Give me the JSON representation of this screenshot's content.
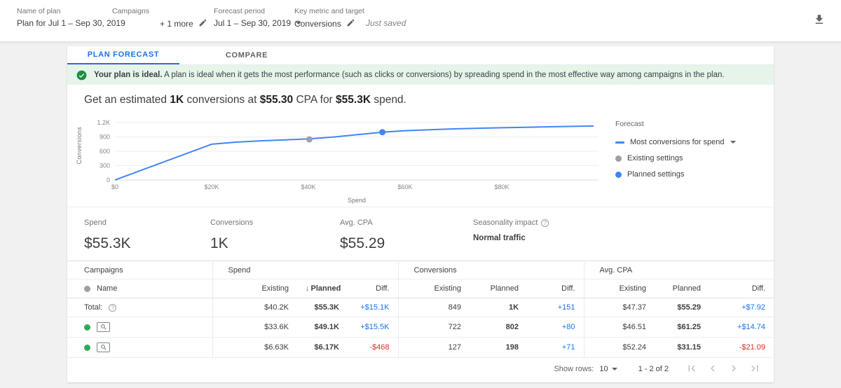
{
  "topbar": {
    "plan": {
      "label": "Name of plan",
      "value": "Plan for Jul 1 – Sep 30, 2019"
    },
    "campaigns": {
      "label": "Campaigns",
      "value": "+ 1 more"
    },
    "forecast_period": {
      "label": "Forecast period",
      "value": "Jul 1 – Sep 30, 2019"
    },
    "key_metric": {
      "label": "Key metric and target",
      "value": "Conversions"
    },
    "save_status": "Just saved"
  },
  "tabs": {
    "plan_forecast": "PLAN FORECAST",
    "compare": "COMPARE"
  },
  "banner": {
    "title": "Your plan is ideal.",
    "body": "A plan is ideal when it gets the most performance (such as clicks or conversions) by spreading spend in the most effective way among campaigns in the plan."
  },
  "headline": {
    "p1": "Get an estimated ",
    "b1": "1K",
    "p2": " conversions at ",
    "b2": "$55.30",
    "p3": " CPA for ",
    "b3": "$55.3K",
    "p4": " spend."
  },
  "chart_data": {
    "type": "line",
    "title": "Forecast: conversions vs spend",
    "xlabel": "Spend",
    "ylabel": "Conversions",
    "xlim": [
      0,
      100000
    ],
    "ylim": [
      0,
      1200
    ],
    "grid": true,
    "legend_position": "right",
    "x_tick_values": [
      0,
      20000,
      40000,
      60000,
      80000
    ],
    "x_ticks": [
      "$0",
      "$20K",
      "$40K",
      "$60K",
      "$80K"
    ],
    "y_tick_values": [
      0,
      300,
      600,
      900,
      1200
    ],
    "y_ticks": [
      "0",
      "300",
      "600",
      "900",
      "1.2K"
    ],
    "series": [
      {
        "name": "Most conversions for spend",
        "color": "#4285f4",
        "x": [
          0,
          20000,
          25000,
          30000,
          35000,
          40200,
          45000,
          50000,
          55300,
          60000,
          70000,
          80000,
          90000,
          99000
        ],
        "y": [
          0,
          748,
          790,
          818,
          838,
          860,
          895,
          945,
          1000,
          1030,
          1068,
          1092,
          1112,
          1128
        ]
      }
    ],
    "points": [
      {
        "name": "Existing settings",
        "x": 40200,
        "y": 849,
        "color": "#9aa0a6"
      },
      {
        "name": "Planned settings",
        "x": 55300,
        "y": 1000,
        "color": "#4285f4"
      }
    ]
  },
  "legend": {
    "title": "Forecast",
    "series_label": "Most conversions for spend",
    "existing_label": "Existing settings",
    "planned_label": "Planned settings"
  },
  "summary": {
    "spend": {
      "label": "Spend",
      "value": "$55.3K"
    },
    "conversions": {
      "label": "Conversions",
      "value": "1K"
    },
    "avg_cpa": {
      "label": "Avg. CPA",
      "value": "$55.29"
    },
    "seasonality": {
      "label": "Seasonality impact",
      "value": "Normal traffic"
    }
  },
  "table": {
    "group_headers": {
      "campaigns": "Campaigns",
      "spend": "Spend",
      "conversions": "Conversions",
      "avg_cpa": "Avg. CPA"
    },
    "subheaders": {
      "name": "Name",
      "existing": "Existing",
      "planned": "Planned",
      "diff": "Diff."
    },
    "rows": [
      {
        "name": "Total:",
        "spend_existing": "$40.2K",
        "spend_planned": "$55.3K",
        "spend_diff": "+$15.1K",
        "conv_existing": "849",
        "conv_planned": "1K",
        "conv_diff": "+151",
        "cpa_existing": "$47.37",
        "cpa_planned": "$55.29",
        "cpa_diff": "+$7.92"
      },
      {
        "spend_existing": "$33.6K",
        "spend_planned": "$49.1K",
        "spend_diff": "+$15.5K",
        "conv_existing": "722",
        "conv_planned": "802",
        "conv_diff": "+80",
        "cpa_existing": "$46.51",
        "cpa_planned": "$61.25",
        "cpa_diff": "+$14.74"
      },
      {
        "spend_existing": "$6.63K",
        "spend_planned": "$6.17K",
        "spend_diff": "-$468",
        "conv_existing": "127",
        "conv_planned": "198",
        "conv_diff": "+71",
        "cpa_existing": "$52.24",
        "cpa_planned": "$31.15",
        "cpa_diff": "-$21.09"
      }
    ],
    "footer": {
      "show_rows_label": "Show rows:",
      "show_rows_value": "10",
      "range": "1 - 2 of 2"
    }
  },
  "colors": {
    "accent": "#1a73e8",
    "chart_line": "#4285f4",
    "positive_diff": "#1a73e8",
    "negative_diff": "#d93025",
    "banner_bg": "#e6f4ea",
    "success_green": "#34a853"
  }
}
